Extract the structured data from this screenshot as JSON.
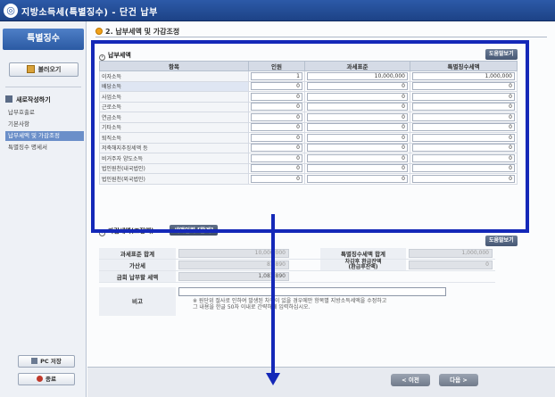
{
  "app": {
    "title": "지방소득세(특별징수) - 단건 납부"
  },
  "sidebar": {
    "header": "특별징수",
    "load_button": "불러오기",
    "new_label": "새로작성하기",
    "menu": [
      {
        "label": "납부호출로",
        "active": false
      },
      {
        "label": "기본사항",
        "active": false
      },
      {
        "label": "납부세액 및 가감조정",
        "active": true
      },
      {
        "label": "특별징수 명세서",
        "active": false
      }
    ],
    "pc_save_button": "PC 저장",
    "exit_button": "종료"
  },
  "main": {
    "step_title": "2. 납부세액 및 가감조정",
    "tax_section_title": "납부세액",
    "help_button": "도움말보기",
    "table": {
      "headers": [
        "항목",
        "인원",
        "과세표준",
        "특별징수세액"
      ],
      "rows": [
        {
          "label": "이자소득",
          "count": "1",
          "base": "10,000,000",
          "tax": "1,000,000"
        },
        {
          "label": "배당소득",
          "count": "0",
          "base": "0",
          "tax": "0"
        },
        {
          "label": "사업소득",
          "count": "0",
          "base": "0",
          "tax": "0"
        },
        {
          "label": "근로소득",
          "count": "0",
          "base": "0",
          "tax": "0"
        },
        {
          "label": "연금소득",
          "count": "0",
          "base": "0",
          "tax": "0"
        },
        {
          "label": "기타소득",
          "count": "0",
          "base": "0",
          "tax": "0"
        },
        {
          "label": "퇴직소득",
          "count": "0",
          "base": "0",
          "tax": "0"
        },
        {
          "label": "저축해지추징세액 등",
          "count": "0",
          "base": "0",
          "tax": "0"
        },
        {
          "label": "비거주자 양도소득",
          "count": "0",
          "base": "0",
          "tax": "0"
        },
        {
          "label": "법인원천(내국법인)",
          "count": "0",
          "base": "0",
          "tax": "0"
        },
        {
          "label": "법인원천(외국법인)",
          "count": "0",
          "base": "0",
          "tax": "0"
        }
      ]
    },
    "adjust_section_title": "가감세액(조정액)",
    "detail_button": "세액입력 [합계]",
    "help_button_2": "도움말보기",
    "summary": {
      "base_total_label": "과세표준 합계",
      "base_total_value": "10,000,000",
      "tax_total_label": "특별징수세액 합계",
      "tax_total_value": "1,000,000",
      "penalty_label": "가산세",
      "penalty_value": "81,890",
      "refund_label_1": "차감후 환급잔액",
      "refund_label_2": "(환급후잔액)",
      "refund_value": "0",
      "pay_label": "금회 납부할 세액",
      "pay_value": "1,081,890"
    },
    "memo_label": "비고",
    "memo_note_1": "※ 원단위 절사로 인하여 발생된 차액이 있을 경우에만 항목별 지방소득세액을 수정하고",
    "memo_note_2": "그 내용을 한글 50자 이내로 간략하게 입력하십시오."
  },
  "footer": {
    "prev_button": "< 이전",
    "next_button": "다음 >"
  },
  "colors": {
    "highlight": "#1428b8",
    "accent": "#2c5aa8"
  }
}
